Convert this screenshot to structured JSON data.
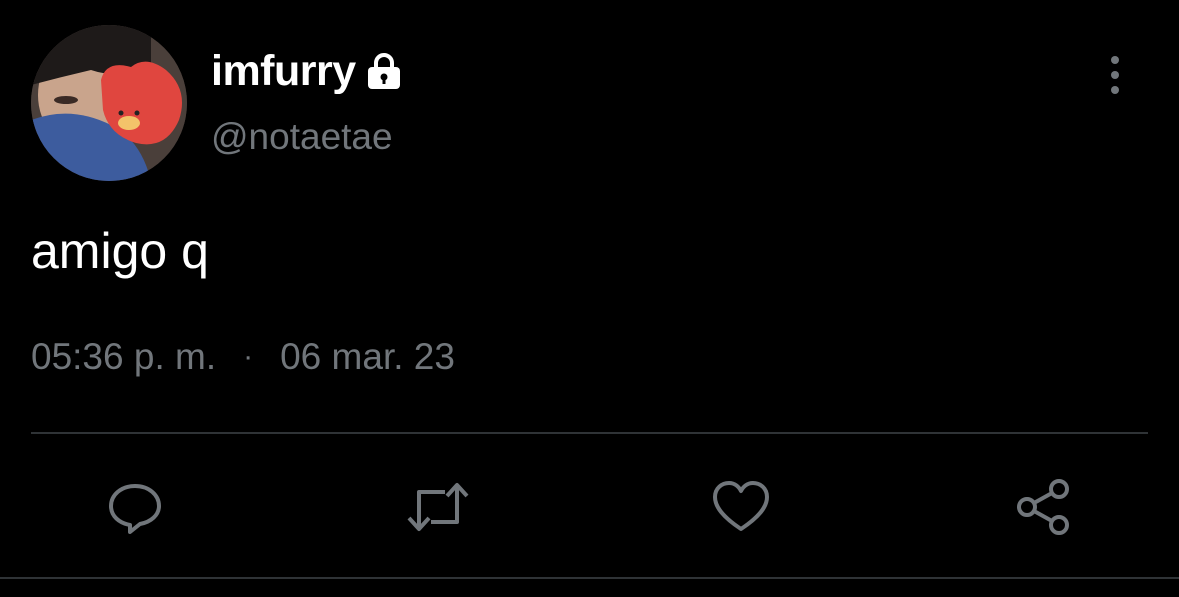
{
  "user": {
    "display_name": "imfurry",
    "handle": "@notaetae",
    "protected_icon": "lock-icon",
    "avatar_icon": "profile-photo"
  },
  "tweet": {
    "text": "amigo q",
    "time": "05:36 p. m.",
    "separator": "·",
    "date": "06 mar. 23"
  },
  "actions": [
    {
      "name": "reply",
      "icon": "speech-bubble-icon"
    },
    {
      "name": "retweet",
      "icon": "retweet-icon"
    },
    {
      "name": "like",
      "icon": "heart-icon"
    },
    {
      "name": "share",
      "icon": "share-icon"
    }
  ],
  "colors": {
    "background": "#000000",
    "primary_text": "#ffffff",
    "secondary_text": "#71767b",
    "divider": "#2f3336"
  }
}
